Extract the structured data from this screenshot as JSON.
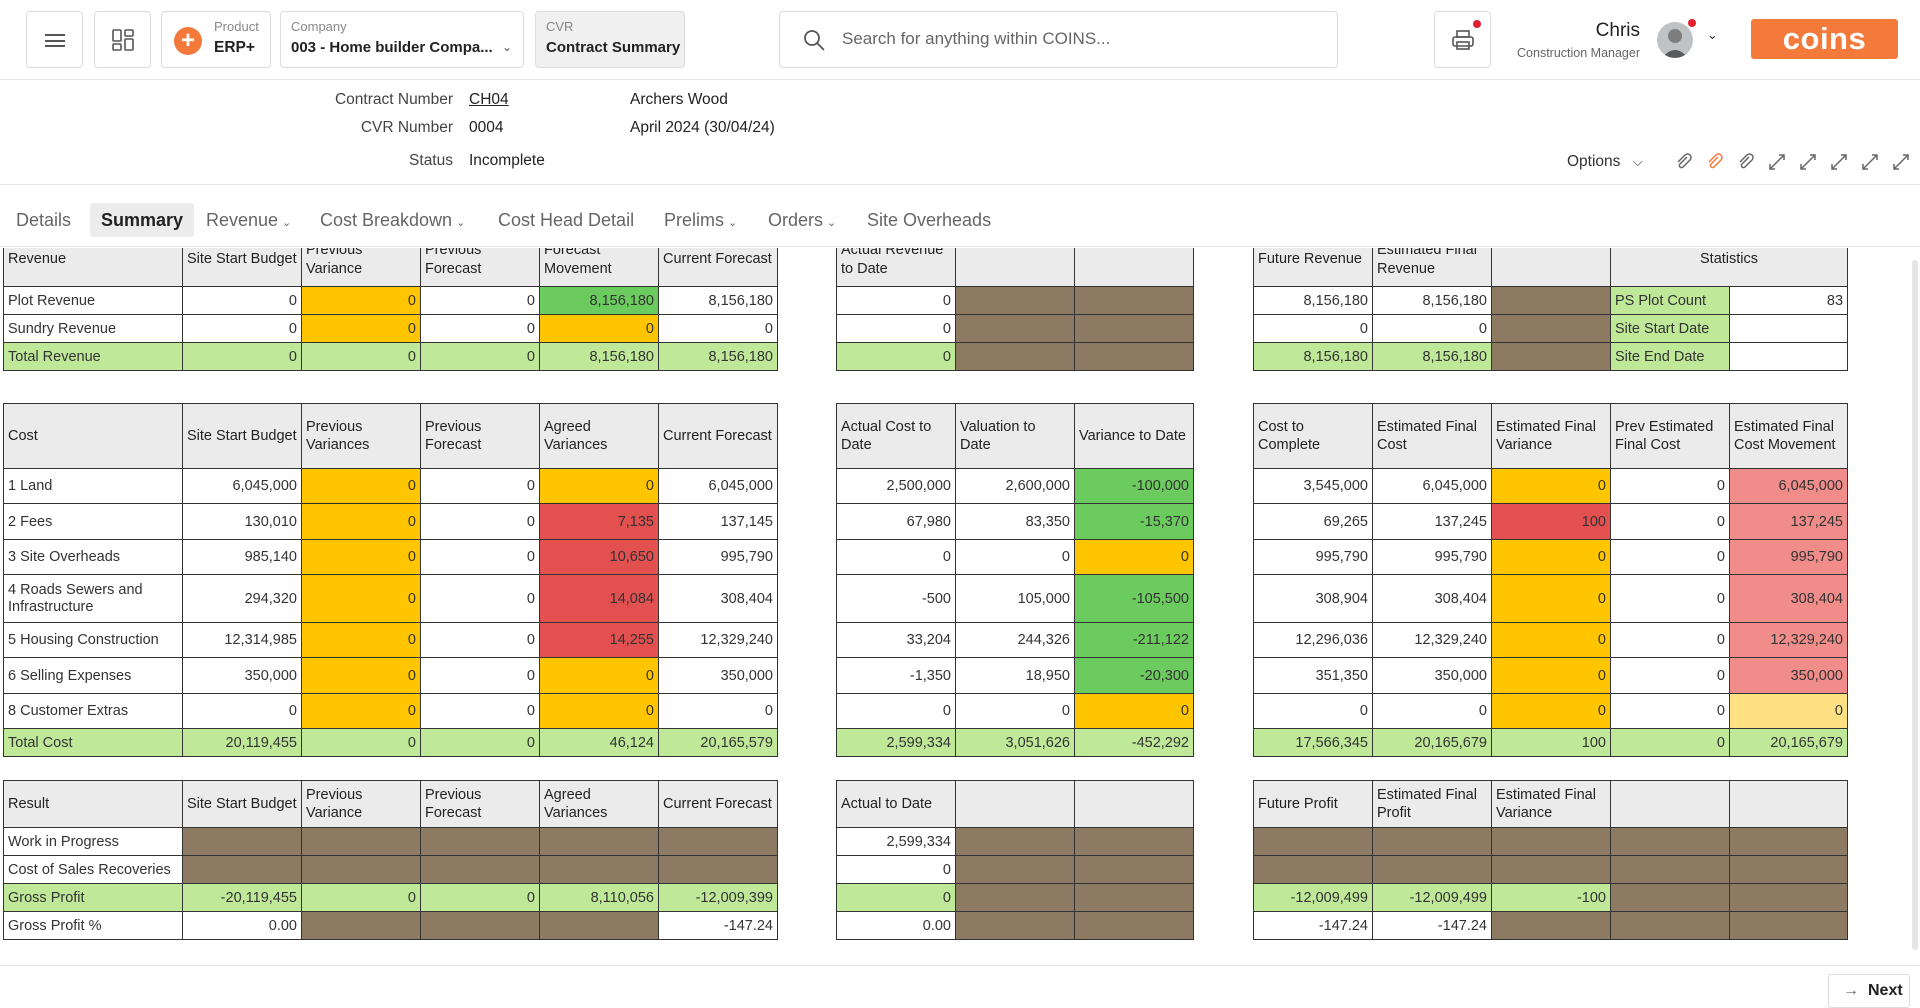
{
  "topbar": {
    "product_label": "Product",
    "product_value": "ERP+",
    "company_label": "Company",
    "company_value": "003 - Home builder Compa...",
    "cvr_label": "CVR",
    "cvr_value": "Contract Summary",
    "search_placeholder": "Search for anything within COINS...",
    "user_name": "Chris",
    "user_role": "Construction Manager",
    "logo": "coins"
  },
  "header": {
    "contract_number_label": "Contract Number",
    "contract_number": "CH04",
    "contract_name": "Archers Wood",
    "cvr_number_label": "CVR Number",
    "cvr_number": "0004",
    "period": "April 2024 (30/04/24)",
    "status_label": "Status",
    "status": "Incomplete",
    "options_label": "Options"
  },
  "tabs": [
    {
      "label": "Details",
      "dropdown": false
    },
    {
      "label": "Summary",
      "dropdown": false,
      "active": true
    },
    {
      "label": "Revenue",
      "dropdown": true
    },
    {
      "label": "Cost Breakdown",
      "dropdown": true
    },
    {
      "label": "Cost Head Detail",
      "dropdown": false
    },
    {
      "label": "Prelims",
      "dropdown": true
    },
    {
      "label": "Orders",
      "dropdown": true
    },
    {
      "label": "Site Overheads",
      "dropdown": false
    }
  ],
  "revenue": {
    "left": {
      "headers": [
        "Revenue",
        "Site Start Budget",
        "Previous Variance",
        "Previous Forecast",
        "Forecast Movement",
        "Current Forecast"
      ],
      "rows": [
        {
          "cells": [
            "Plot Revenue",
            "0",
            "0",
            "0",
            "8,156,180",
            "8,156,180"
          ],
          "colors": [
            "w",
            "w",
            "y",
            "w",
            "g",
            "w"
          ]
        },
        {
          "cells": [
            "Sundry Revenue",
            "0",
            "0",
            "0",
            "0",
            "0"
          ],
          "colors": [
            "w",
            "w",
            "y",
            "w",
            "y",
            "w"
          ]
        },
        {
          "cells": [
            "Total Revenue",
            "0",
            "0",
            "0",
            "8,156,180",
            "8,156,180"
          ],
          "colors": [
            "lg",
            "lg",
            "lg",
            "lg",
            "lg",
            "lg"
          ]
        }
      ]
    },
    "mid": {
      "headers": [
        "Actual Revenue to Date",
        "",
        ""
      ],
      "rows": [
        {
          "cells": [
            "0",
            "",
            ""
          ],
          "colors": [
            "w",
            "br",
            "br"
          ]
        },
        {
          "cells": [
            "0",
            "",
            ""
          ],
          "colors": [
            "w",
            "br",
            "br"
          ]
        },
        {
          "cells": [
            "0",
            "",
            ""
          ],
          "colors": [
            "lg",
            "br",
            "br"
          ]
        }
      ]
    },
    "right": {
      "headers": [
        "Future Revenue",
        "Estimated Final Revenue",
        ""
      ],
      "rows": [
        {
          "cells": [
            "8,156,180",
            "8,156,180",
            ""
          ],
          "colors": [
            "w",
            "w",
            "br"
          ]
        },
        {
          "cells": [
            "0",
            "0",
            ""
          ],
          "colors": [
            "w",
            "w",
            "br"
          ]
        },
        {
          "cells": [
            "8,156,180",
            "8,156,180",
            ""
          ],
          "colors": [
            "lg",
            "lg",
            "br"
          ]
        }
      ]
    },
    "stats": {
      "header": "Statistics",
      "rows": [
        {
          "label": "PS Plot Count",
          "value": "83"
        },
        {
          "label": "Site Start Date",
          "value": ""
        },
        {
          "label": "Site End Date",
          "value": ""
        }
      ]
    }
  },
  "cost": {
    "left": {
      "headers": [
        "Cost",
        "Site Start Budget",
        "Previous Variances",
        "Previous Forecast",
        "Agreed Variances",
        "Current Forecast"
      ],
      "rows": [
        {
          "cells": [
            "1 Land",
            "6,045,000",
            "0",
            "0",
            "0",
            "6,045,000"
          ],
          "colors": [
            "w",
            "w",
            "y",
            "w",
            "y",
            "w"
          ]
        },
        {
          "cells": [
            "2 Fees",
            "130,010",
            "0",
            "0",
            "7,135",
            "137,145"
          ],
          "colors": [
            "w",
            "w",
            "y",
            "w",
            "r",
            "w"
          ]
        },
        {
          "cells": [
            "3 Site Overheads",
            "985,140",
            "0",
            "0",
            "10,650",
            "995,790"
          ],
          "colors": [
            "w",
            "w",
            "y",
            "w",
            "r",
            "w"
          ]
        },
        {
          "cells": [
            "4 Roads Sewers and Infrastructure",
            "294,320",
            "0",
            "0",
            "14,084",
            "308,404"
          ],
          "colors": [
            "w",
            "w",
            "y",
            "w",
            "r",
            "w"
          ],
          "tall": true
        },
        {
          "cells": [
            "5 Housing Construction",
            "12,314,985",
            "0",
            "0",
            "14,255",
            "12,329,240"
          ],
          "colors": [
            "w",
            "w",
            "y",
            "w",
            "r",
            "w"
          ]
        },
        {
          "cells": [
            "6 Selling Expenses",
            "350,000",
            "0",
            "0",
            "0",
            "350,000"
          ],
          "colors": [
            "w",
            "w",
            "y",
            "w",
            "y",
            "w"
          ]
        },
        {
          "cells": [
            "8 Customer Extras",
            "0",
            "0",
            "0",
            "0",
            "0"
          ],
          "colors": [
            "w",
            "w",
            "y",
            "w",
            "y",
            "w"
          ]
        },
        {
          "cells": [
            "Total Cost",
            "20,119,455",
            "0",
            "0",
            "46,124",
            "20,165,579"
          ],
          "colors": [
            "lg",
            "lg",
            "lg",
            "lg",
            "lg",
            "lg"
          ],
          "short": true
        }
      ]
    },
    "mid": {
      "headers": [
        "Actual Cost to Date",
        "Valuation to Date",
        "Variance to Date"
      ],
      "rows": [
        {
          "cells": [
            "2,500,000",
            "2,600,000",
            "-100,000"
          ],
          "colors": [
            "w",
            "w",
            "g"
          ]
        },
        {
          "cells": [
            "67,980",
            "83,350",
            "-15,370"
          ],
          "colors": [
            "w",
            "w",
            "g"
          ]
        },
        {
          "cells": [
            "0",
            "0",
            "0"
          ],
          "colors": [
            "w",
            "w",
            "y"
          ]
        },
        {
          "cells": [
            "-500",
            "105,000",
            "-105,500"
          ],
          "colors": [
            "w",
            "w",
            "g"
          ],
          "tall": true
        },
        {
          "cells": [
            "33,204",
            "244,326",
            "-211,122"
          ],
          "colors": [
            "w",
            "w",
            "g"
          ]
        },
        {
          "cells": [
            "-1,350",
            "18,950",
            "-20,300"
          ],
          "colors": [
            "w",
            "w",
            "g"
          ]
        },
        {
          "cells": [
            "0",
            "0",
            "0"
          ],
          "colors": [
            "w",
            "w",
            "y"
          ]
        },
        {
          "cells": [
            "2,599,334",
            "3,051,626",
            "-452,292"
          ],
          "colors": [
            "lg",
            "lg",
            "lg"
          ],
          "short": true
        }
      ]
    },
    "right": {
      "headers": [
        "Cost to Complete",
        "Estimated Final Cost",
        "Estimated Final Variance",
        "Prev Estimated Final Cost",
        "Estimated Final Cost Movement"
      ],
      "rows": [
        {
          "cells": [
            "3,545,000",
            "6,045,000",
            "0",
            "0",
            "6,045,000"
          ],
          "colors": [
            "w",
            "w",
            "y",
            "w",
            "p"
          ]
        },
        {
          "cells": [
            "69,265",
            "137,245",
            "100",
            "0",
            "137,245"
          ],
          "colors": [
            "w",
            "w",
            "r",
            "w",
            "p"
          ]
        },
        {
          "cells": [
            "995,790",
            "995,790",
            "0",
            "0",
            "995,790"
          ],
          "colors": [
            "w",
            "w",
            "y",
            "w",
            "p"
          ]
        },
        {
          "cells": [
            "308,904",
            "308,404",
            "0",
            "0",
            "308,404"
          ],
          "colors": [
            "w",
            "w",
            "y",
            "w",
            "p"
          ],
          "tall": true
        },
        {
          "cells": [
            "12,296,036",
            "12,329,240",
            "0",
            "0",
            "12,329,240"
          ],
          "colors": [
            "w",
            "w",
            "y",
            "w",
            "p"
          ]
        },
        {
          "cells": [
            "351,350",
            "350,000",
            "0",
            "0",
            "350,000"
          ],
          "colors": [
            "w",
            "w",
            "y",
            "w",
            "p"
          ]
        },
        {
          "cells": [
            "0",
            "0",
            "0",
            "0",
            "0"
          ],
          "colors": [
            "w",
            "w",
            "y",
            "w",
            "ly"
          ]
        },
        {
          "cells": [
            "17,566,345",
            "20,165,679",
            "100",
            "0",
            "20,165,679"
          ],
          "colors": [
            "lg",
            "lg",
            "lg",
            "lg",
            "lg"
          ],
          "short": true
        }
      ]
    }
  },
  "result": {
    "left": {
      "headers": [
        "Result",
        "Site Start Budget",
        "Previous Variance",
        "Previous Forecast",
        "Agreed Variances",
        "Current Forecast"
      ],
      "rows": [
        {
          "cells": [
            "Work in Progress",
            "",
            "",
            "",
            "",
            ""
          ],
          "colors": [
            "w",
            "br",
            "br",
            "br",
            "br",
            "br"
          ]
        },
        {
          "cells": [
            "Cost of Sales Recoveries",
            "",
            "",
            "",
            "",
            ""
          ],
          "colors": [
            "w",
            "br",
            "br",
            "br",
            "br",
            "br"
          ]
        },
        {
          "cells": [
            "Gross Profit",
            "-20,119,455",
            "0",
            "0",
            "8,110,056",
            "-12,009,399"
          ],
          "colors": [
            "lg",
            "lg",
            "lg",
            "lg",
            "lg",
            "lg"
          ]
        },
        {
          "cells": [
            "Gross Profit %",
            "0.00",
            "",
            "",
            "",
            "-147.24"
          ],
          "colors": [
            "w",
            "w",
            "br",
            "br",
            "br",
            "w"
          ]
        }
      ]
    },
    "mid": {
      "headers": [
        "Actual to Date",
        "",
        ""
      ],
      "rows": [
        {
          "cells": [
            "2,599,334",
            "",
            ""
          ],
          "colors": [
            "w",
            "br",
            "br"
          ]
        },
        {
          "cells": [
            "0",
            "",
            ""
          ],
          "colors": [
            "w",
            "br",
            "br"
          ]
        },
        {
          "cells": [
            "0",
            "",
            ""
          ],
          "colors": [
            "lg",
            "br",
            "br"
          ]
        },
        {
          "cells": [
            "0.00",
            "",
            ""
          ],
          "colors": [
            "w",
            "br",
            "br"
          ]
        }
      ]
    },
    "right": {
      "headers": [
        "Future Profit",
        "Estimated Final Profit",
        "Estimated Final Variance",
        "",
        ""
      ],
      "rows": [
        {
          "cells": [
            "",
            "",
            "",
            "",
            ""
          ],
          "colors": [
            "br",
            "br",
            "br",
            "br",
            "br"
          ]
        },
        {
          "cells": [
            "",
            "",
            "",
            "",
            ""
          ],
          "colors": [
            "br",
            "br",
            "br",
            "br",
            "br"
          ]
        },
        {
          "cells": [
            "-12,009,499",
            "-12,009,499",
            "-100",
            "",
            ""
          ],
          "colors": [
            "lg",
            "lg",
            "lg",
            "br",
            "br"
          ]
        },
        {
          "cells": [
            "-147.24",
            "-147.24",
            "",
            "",
            ""
          ],
          "colors": [
            "w",
            "w",
            "br",
            "br",
            "br"
          ]
        }
      ]
    }
  },
  "footer": {
    "next_label": "Next"
  }
}
